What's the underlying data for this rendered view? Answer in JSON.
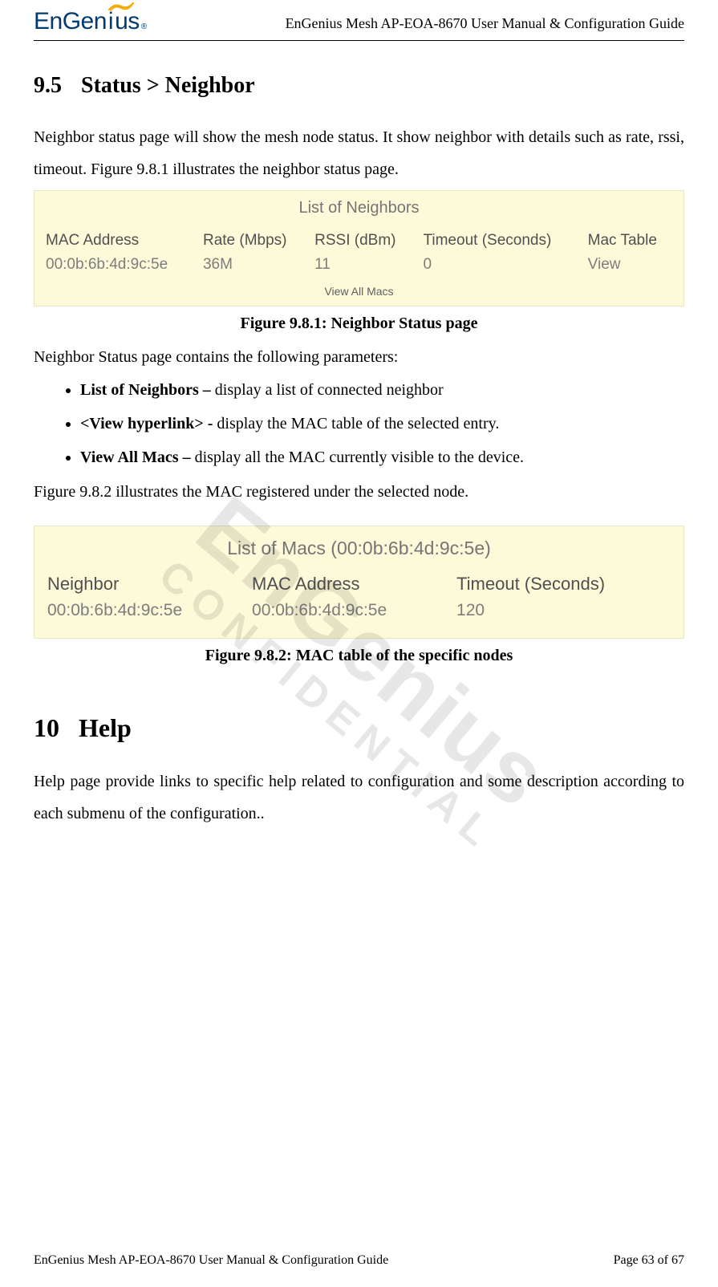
{
  "header": {
    "logo_text_1": "EnGen",
    "logo_text_2": "i",
    "logo_text_3": "us",
    "logo_reg": "®",
    "doc_title": "EnGenius Mesh AP-EOA-8670 User Manual & Configuration Guide"
  },
  "section95": {
    "number": "9.5",
    "title": "Status > Neighbor",
    "para": "Neighbor status page will show the mesh node status. It show neighbor with details such as rate, rssi, timeout. Figure 9.8.1 illustrates the neighbor status page."
  },
  "fig981": {
    "panel_title": "List of Neighbors",
    "headers": [
      "MAC Address",
      "Rate (Mbps)",
      "RSSI (dBm)",
      "Timeout (Seconds)",
      "Mac Table"
    ],
    "row": [
      "00:0b:6b:4d:9c:5e",
      "36M",
      "11",
      "0",
      "View"
    ],
    "footer_link": "View All Macs",
    "caption": "Figure 9.8.1: Neighbor Status page"
  },
  "params_intro": "Neighbor Status page contains the following parameters:",
  "params": [
    {
      "term": "List of Neighbors –",
      "desc": " display a list of connected neighbor"
    },
    {
      "term": "<View hyperlink> -",
      "desc": " display the MAC table of the selected entry."
    },
    {
      "term": "View All Macs –",
      "desc": " display all the MAC currently visible to the device."
    }
  ],
  "after_params": "Figure 9.8.2 illustrates the MAC registered under the selected node.",
  "fig982": {
    "panel_title": "List of Macs (00:0b:6b:4d:9c:5e)",
    "headers": [
      "Neighbor",
      "MAC Address",
      "Timeout (Seconds)"
    ],
    "row": [
      "00:0b:6b:4d:9c:5e",
      "00:0b:6b:4d:9c:5e",
      "120"
    ],
    "caption": "Figure 9.8.2: MAC table of the specific nodes"
  },
  "chapter10": {
    "number": "10",
    "title": "Help",
    "para": "Help page provide links to specific help related to configuration and some description according to each submenu of the configuration.."
  },
  "watermark": {
    "line1": "EnGenius",
    "line2": "CONFIDENTIAL"
  },
  "footer": {
    "left": "EnGenius Mesh AP-EOA-8670 User Manual & Configuration Guide",
    "right": "Page 63 of 67"
  }
}
